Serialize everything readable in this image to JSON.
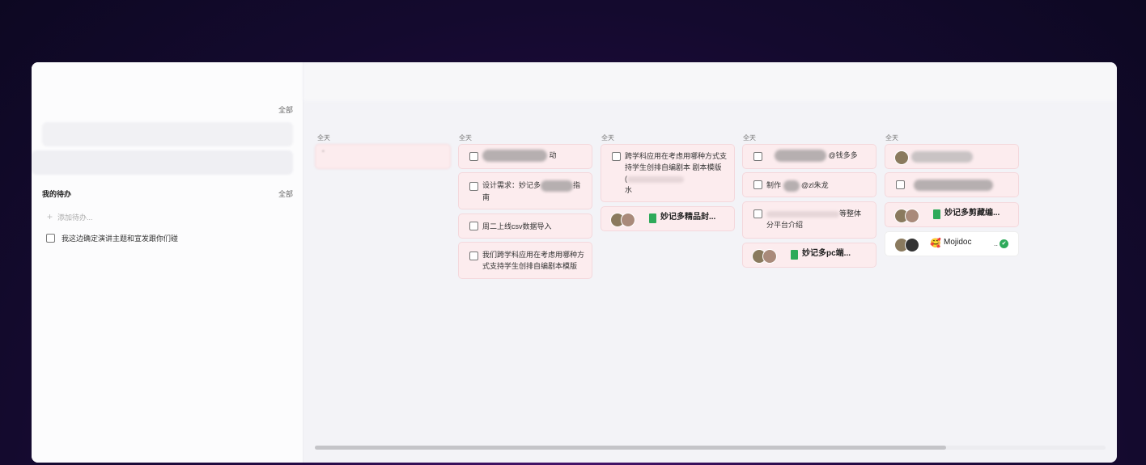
{
  "sidebar": {
    "all_top": "全部",
    "section_title": "我的待办",
    "all_section": "全部",
    "add_placeholder": "添加待办...",
    "add_icon": "+",
    "todos": [
      "我这边确定演讲主题和宣发跟你们碰"
    ]
  },
  "columns": [
    {
      "label": "全天",
      "cards": [
        {
          "type": "blur",
          "text": "-"
        }
      ]
    },
    {
      "label": "全天",
      "cards": [
        {
          "type": "task",
          "text": "动"
        },
        {
          "type": "task",
          "text_a": "设计需求：妙记多",
          "text_b": "指南"
        },
        {
          "type": "task",
          "text": "周二上线csv数据导入"
        },
        {
          "type": "task",
          "text": "我们跨学科应用在考虑用哪种方式支持学生创排自编剧本模版"
        }
      ]
    },
    {
      "label": "全天",
      "cards": [
        {
          "type": "task",
          "text_a": "跨学科应用在考虑用哪种方式支持学生创排自编剧本 剧本模版",
          "text_b": "(",
          "text_c": "水"
        },
        {
          "type": "doc",
          "title": "妙记多精品封..."
        }
      ]
    },
    {
      "label": "全天",
      "cards": [
        {
          "type": "task",
          "text": "@钱多多"
        },
        {
          "type": "task",
          "text_a": "制作",
          "text_b": "@zl朱龙"
        },
        {
          "type": "task",
          "text_a": "等整体",
          "text_b": "分平台介绍"
        },
        {
          "type": "doc",
          "title": "妙记多pc端..."
        }
      ]
    },
    {
      "label": "全天",
      "cards": [
        {
          "type": "blur"
        },
        {
          "type": "task"
        },
        {
          "type": "doc",
          "title": "妙记多剪藏编..."
        },
        {
          "type": "mojidoc",
          "title": "Mojidoc",
          "suffix": "..",
          "emoji": "🥰",
          "check": "✔"
        }
      ]
    }
  ],
  "colors": {
    "card_bg": "#fcecee",
    "doc_icon": "#2eaa5a",
    "check_green": "#2eaa5a"
  }
}
